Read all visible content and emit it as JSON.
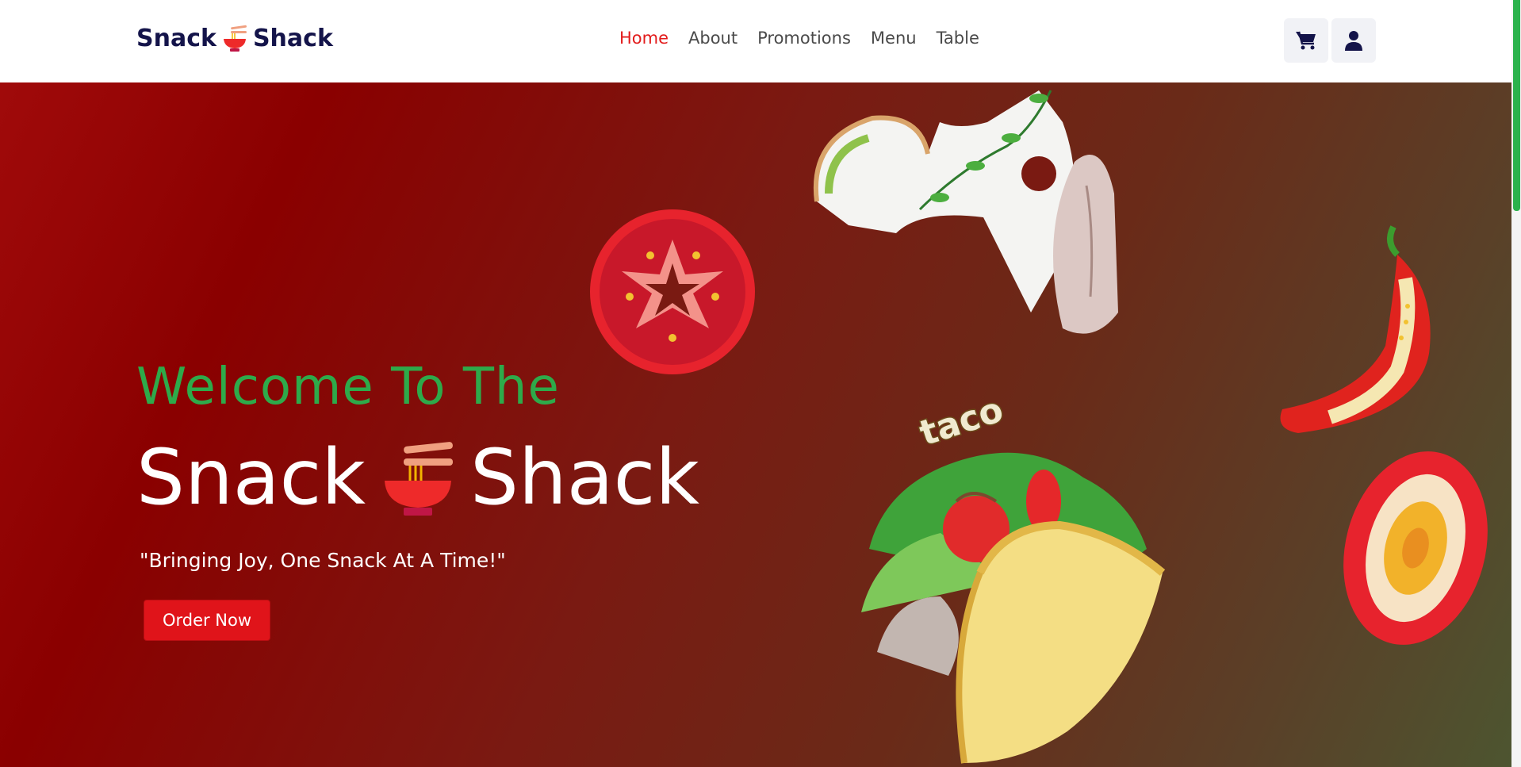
{
  "navbar": {
    "brand": {
      "left": "Snack",
      "right": "Shack",
      "logo_icon": "noodle-bowl-icon"
    },
    "links": [
      {
        "label": "Home",
        "active": true
      },
      {
        "label": "About",
        "active": false
      },
      {
        "label": "Promotions",
        "active": false
      },
      {
        "label": "Menu",
        "active": false
      },
      {
        "label": "Table",
        "active": false
      }
    ],
    "icons": [
      "cart-icon",
      "user-icon"
    ]
  },
  "hero": {
    "welcome": "Welcome To The",
    "title_left": "Snack",
    "title_right": "Shack",
    "tagline": "\"Bringing Joy, One Snack At A Time!\"",
    "cta_label": "Order Now",
    "taco_label": "taco"
  },
  "colors": {
    "brand_navy": "#14144a",
    "accent_red": "#e21b1b",
    "welcome_green": "#2eaa4a",
    "button_red": "#e0141a"
  }
}
